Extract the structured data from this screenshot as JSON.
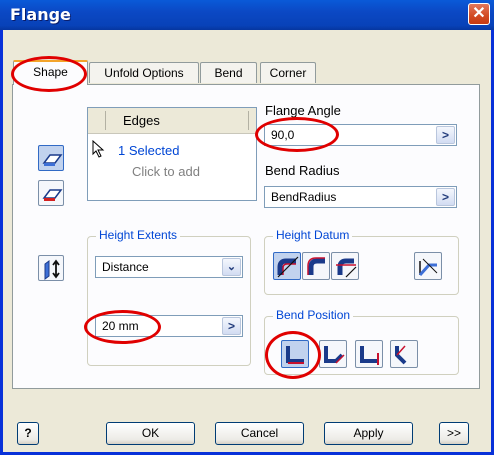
{
  "window": {
    "title": "Flange",
    "close_label": "✕"
  },
  "tabs": [
    {
      "label": "Shape",
      "active": true
    },
    {
      "label": "Unfold Options",
      "active": false
    },
    {
      "label": "Bend",
      "active": false
    },
    {
      "label": "Corner",
      "active": false
    }
  ],
  "edges": {
    "header": "Edges",
    "selected": "1 Selected",
    "click_to_add": "Click to add"
  },
  "flange_angle": {
    "label": "Flange Angle",
    "value": "90,0",
    "button": ">"
  },
  "bend_radius": {
    "label": "Bend Radius",
    "value": "BendRadius",
    "button": ">"
  },
  "height_extents": {
    "legend": "Height Extents",
    "type_value": "Distance",
    "dropdown_glyph": "⌄",
    "distance_value": "20 mm",
    "button": ">"
  },
  "height_datum": {
    "legend": "Height Datum"
  },
  "bend_position": {
    "legend": "Bend Position"
  },
  "buttons": {
    "help": "?",
    "ok": "OK",
    "cancel": "Cancel",
    "apply": "Apply",
    "more": ">>"
  },
  "colors": {
    "title_bar": "#0842b8",
    "group_label": "#0046d5",
    "highlight_ring": "#e00000",
    "dialog_bg": "#ece9d8"
  }
}
